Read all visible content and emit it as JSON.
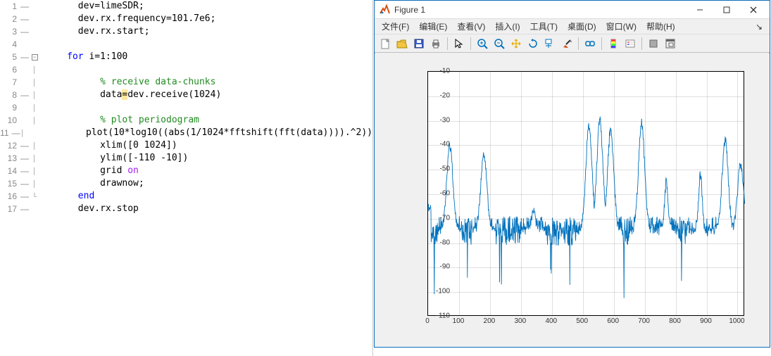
{
  "editor": {
    "lines": [
      {
        "n": 1,
        "dash": "—",
        "fold": "",
        "tokens": [
          {
            "t": "       dev=limeSDR;",
            "c": ""
          }
        ]
      },
      {
        "n": 2,
        "dash": "—",
        "fold": "",
        "tokens": [
          {
            "t": "       dev.rx.frequency=101.7e6;",
            "c": ""
          }
        ]
      },
      {
        "n": 3,
        "dash": "—",
        "fold": "",
        "tokens": [
          {
            "t": "       dev.rx.start;",
            "c": ""
          }
        ]
      },
      {
        "n": 4,
        "dash": "",
        "fold": "",
        "tokens": [
          {
            "t": "",
            "c": ""
          }
        ]
      },
      {
        "n": 5,
        "dash": "—",
        "fold": "[-]",
        "tokens": [
          {
            "t": "     ",
            "c": ""
          },
          {
            "t": "for",
            "c": "kw"
          },
          {
            "t": " i=1:100",
            "c": ""
          }
        ]
      },
      {
        "n": 6,
        "dash": "",
        "fold": "|",
        "tokens": [
          {
            "t": "",
            "c": ""
          }
        ]
      },
      {
        "n": 7,
        "dash": "",
        "fold": "|",
        "tokens": [
          {
            "t": "           ",
            "c": ""
          },
          {
            "t": "% receive data-chunks",
            "c": "cmt"
          }
        ]
      },
      {
        "n": 8,
        "dash": "—",
        "fold": "|",
        "tokens": [
          {
            "t": "           data",
            "c": ""
          },
          {
            "t": "=",
            "c": "hl"
          },
          {
            "t": "dev.receive(1024)",
            "c": ""
          }
        ]
      },
      {
        "n": 9,
        "dash": "",
        "fold": "|",
        "tokens": [
          {
            "t": "",
            "c": ""
          }
        ]
      },
      {
        "n": 10,
        "dash": "",
        "fold": "|",
        "tokens": [
          {
            "t": "           ",
            "c": ""
          },
          {
            "t": "% plot periodogram",
            "c": "cmt"
          }
        ]
      },
      {
        "n": 11,
        "dash": "—",
        "fold": "|",
        "tokens": [
          {
            "t": "           plot(10*log10((abs(1/1024*fftshift(fft(data)))).^2))",
            "c": ""
          }
        ]
      },
      {
        "n": 12,
        "dash": "—",
        "fold": "|",
        "tokens": [
          {
            "t": "           xlim([0 1024])",
            "c": ""
          }
        ]
      },
      {
        "n": 13,
        "dash": "—",
        "fold": "|",
        "tokens": [
          {
            "t": "           ylim([-110 -10])",
            "c": ""
          }
        ]
      },
      {
        "n": 14,
        "dash": "—",
        "fold": "|",
        "tokens": [
          {
            "t": "           grid ",
            "c": ""
          },
          {
            "t": "on",
            "c": "str"
          }
        ]
      },
      {
        "n": 15,
        "dash": "—",
        "fold": "|",
        "tokens": [
          {
            "t": "           drawnow;",
            "c": ""
          }
        ]
      },
      {
        "n": 16,
        "dash": "—",
        "fold": "L",
        "tokens": [
          {
            "t": "       ",
            "c": ""
          },
          {
            "t": "end",
            "c": "kw"
          }
        ]
      },
      {
        "n": 17,
        "dash": "—",
        "fold": "",
        "tokens": [
          {
            "t": "       dev.rx.stop",
            "c": ""
          }
        ]
      }
    ]
  },
  "figure": {
    "title": "Figure 1",
    "menus": [
      "文件(F)",
      "编辑(E)",
      "查看(V)",
      "插入(I)",
      "工具(T)",
      "桌面(D)",
      "窗口(W)",
      "帮助(H)"
    ],
    "toolbar_icons": [
      "new",
      "open",
      "save",
      "print",
      "|",
      "pointer",
      "|",
      "zoom-in",
      "zoom-out",
      "pan",
      "rotate",
      "data-cursor",
      "brush",
      "|",
      "link",
      "|",
      "colorbar",
      "legend",
      "|",
      "hide",
      "dock"
    ]
  },
  "chart_data": {
    "type": "line",
    "xlabel": "",
    "ylabel": "",
    "xlim": [
      0,
      1024
    ],
    "ylim": [
      -110,
      -10
    ],
    "xticks": [
      0,
      100,
      200,
      300,
      400,
      500,
      600,
      700,
      800,
      900,
      1000
    ],
    "yticks": [
      -10,
      -20,
      -30,
      -40,
      -50,
      -60,
      -70,
      -80,
      -90,
      -100,
      -110
    ],
    "grid": true,
    "color": "#0072bd",
    "note": "Power spectral density (dB). Baseline around -75 dB with noise; prominent peaks near x≈70 (-40), x≈180 (-44), strong cluster 520‑600 up to ≈-30, peak near x≈690 (-31), and peak near x≈960 (-38). Occasional dips to ≈-105.",
    "peaks": [
      {
        "x": 70,
        "y": -40
      },
      {
        "x": 180,
        "y": -44
      },
      {
        "x": 340,
        "y": -66
      },
      {
        "x": 520,
        "y": -32
      },
      {
        "x": 555,
        "y": -30
      },
      {
        "x": 590,
        "y": -34
      },
      {
        "x": 690,
        "y": -31
      },
      {
        "x": 770,
        "y": -55
      },
      {
        "x": 880,
        "y": -52
      },
      {
        "x": 960,
        "y": -38
      },
      {
        "x": 1010,
        "y": -48
      }
    ],
    "baseline": -75
  }
}
